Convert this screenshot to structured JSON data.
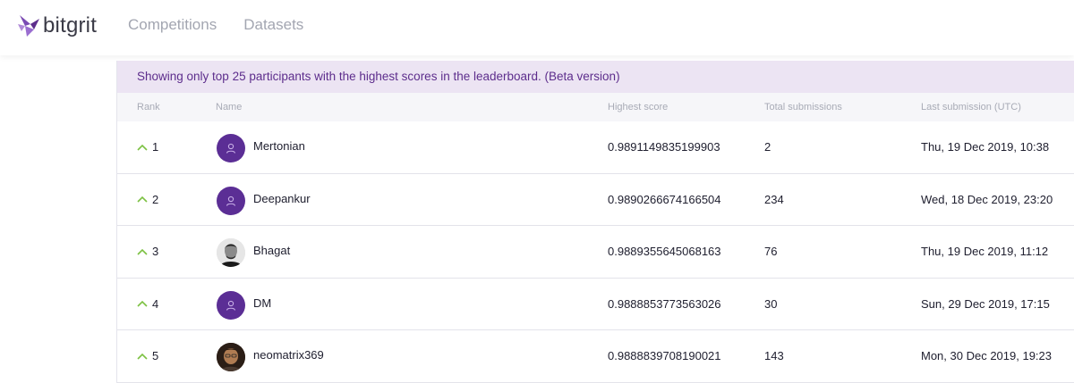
{
  "brand": {
    "name": "bitgrit",
    "color": "#5d2d8c"
  },
  "nav": [
    {
      "label": "Competitions"
    },
    {
      "label": "Datasets"
    }
  ],
  "banner": {
    "text": "Showing only top 25 participants with the highest scores in the leaderboard. (Beta version)"
  },
  "columns": {
    "rank": "Rank",
    "name": "Name",
    "score": "Highest score",
    "submissions": "Total submissions",
    "last": "Last submission (UTC)"
  },
  "rows": [
    {
      "rank": "1",
      "name": "Mertonian",
      "score": "0.9891149835199903",
      "submissions": "2",
      "last": "Thu, 19 Dec 2019, 10:38",
      "avatar": "default-user-icon"
    },
    {
      "rank": "2",
      "name": "Deepankur",
      "score": "0.9890266674166504",
      "submissions": "234",
      "last": "Wed, 18 Dec 2019, 23:20",
      "avatar": "default-user-icon"
    },
    {
      "rank": "3",
      "name": "Bhagat",
      "score": "0.9889355645068163",
      "submissions": "76",
      "last": "Thu, 19 Dec 2019, 11:12",
      "avatar": "user-photo"
    },
    {
      "rank": "4",
      "name": "DM",
      "score": "0.9888853773563026",
      "submissions": "30",
      "last": "Sun, 29 Dec 2019, 17:15",
      "avatar": "default-user-icon"
    },
    {
      "rank": "5",
      "name": "neomatrix369",
      "score": "0.9888839708190021",
      "submissions": "143",
      "last": "Mon, 30 Dec 2019, 19:23",
      "avatar": "user-photo"
    }
  ],
  "colors": {
    "banner_bg": "#ece4f3",
    "rank_up": "#7cc142",
    "avatar_bg": "#5b2e95"
  }
}
